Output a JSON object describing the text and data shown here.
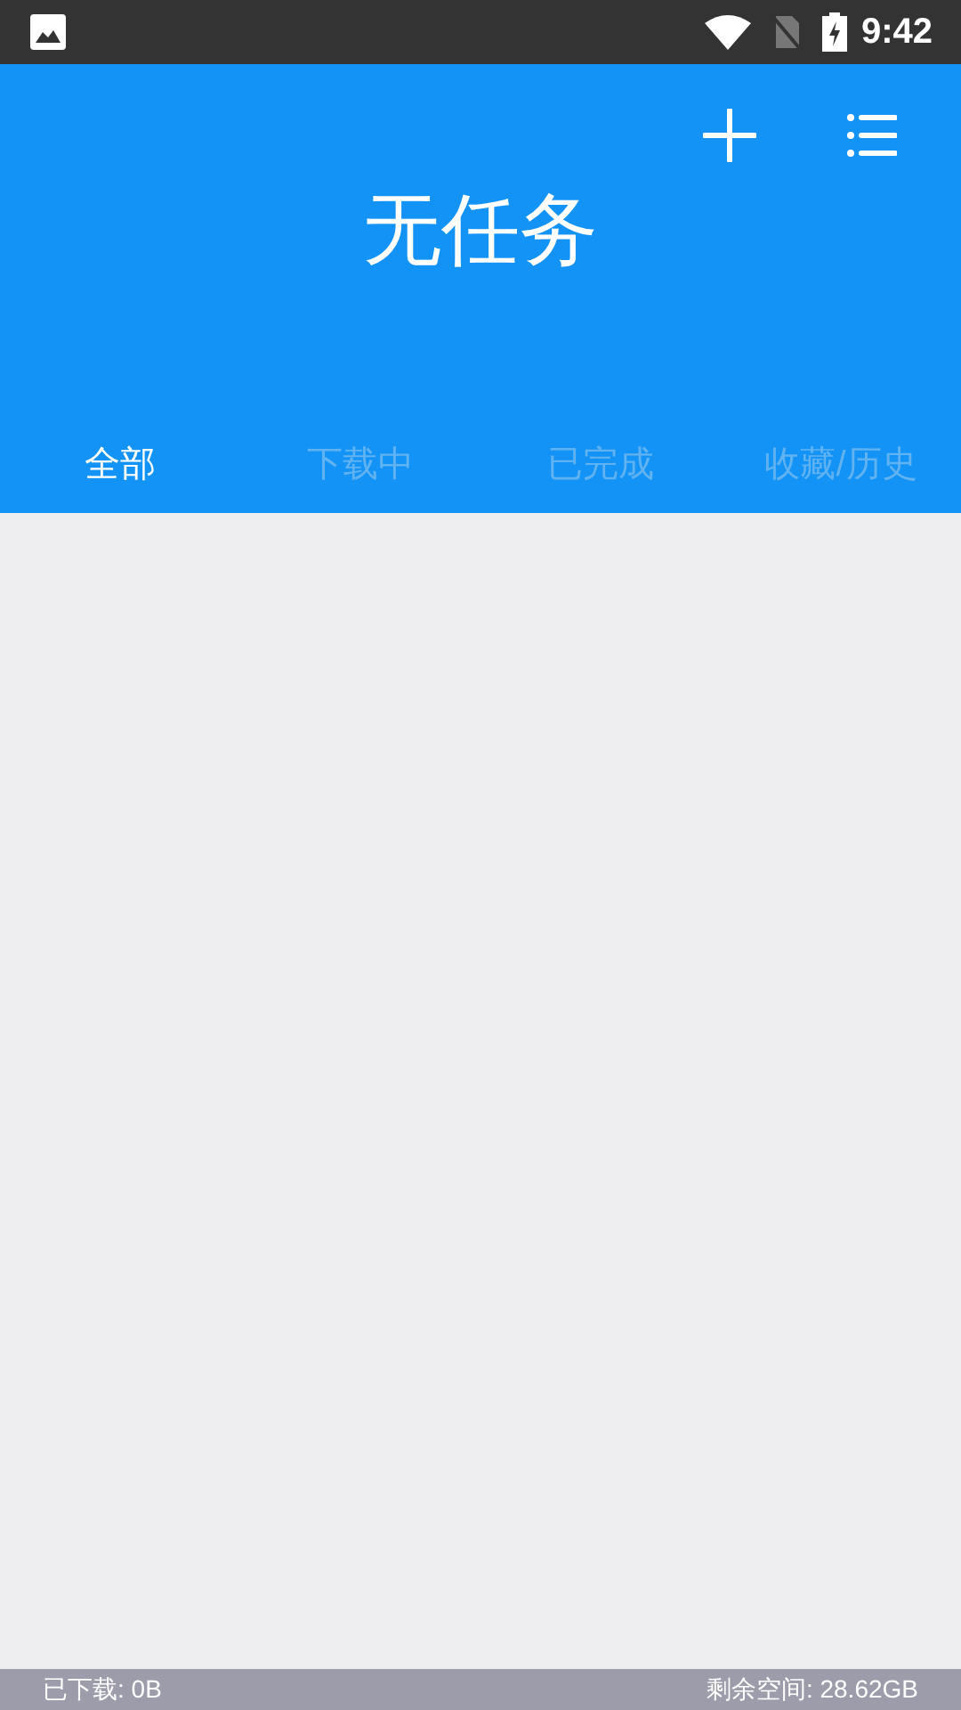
{
  "status_bar": {
    "time": "9:42"
  },
  "header": {
    "title": "无任务"
  },
  "tabs": [
    {
      "label": "全部",
      "selected": true
    },
    {
      "label": "下载中",
      "selected": false
    },
    {
      "label": "已完成",
      "selected": false
    },
    {
      "label": "收藏/历史",
      "selected": false
    }
  ],
  "footer": {
    "downloaded": "已下载: 0B",
    "free_space": "剩余空间: 28.62GB"
  }
}
